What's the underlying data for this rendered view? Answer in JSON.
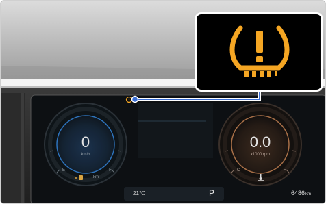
{
  "left_gauge": {
    "value": "0",
    "unit": "km/h",
    "left_label": "E",
    "right_label": "F",
    "sub_label": "km"
  },
  "right_gauge": {
    "value": "0.0",
    "unit": "x1000 rpm",
    "left_label": "C",
    "right_label": "H"
  },
  "status_bar": {
    "temperature": "21℃",
    "gear": "P"
  },
  "odometer": "6486",
  "odometer_unit": "km",
  "callout": {
    "icon": "tire-pressure-warning-icon",
    "icon_color": "#f5a623"
  },
  "colors": {
    "warning_amber": "#f5a623",
    "leader_line": "#3b6fd6",
    "speed_glow": "#2f78c4",
    "rpm_glow": "#b0754a"
  }
}
